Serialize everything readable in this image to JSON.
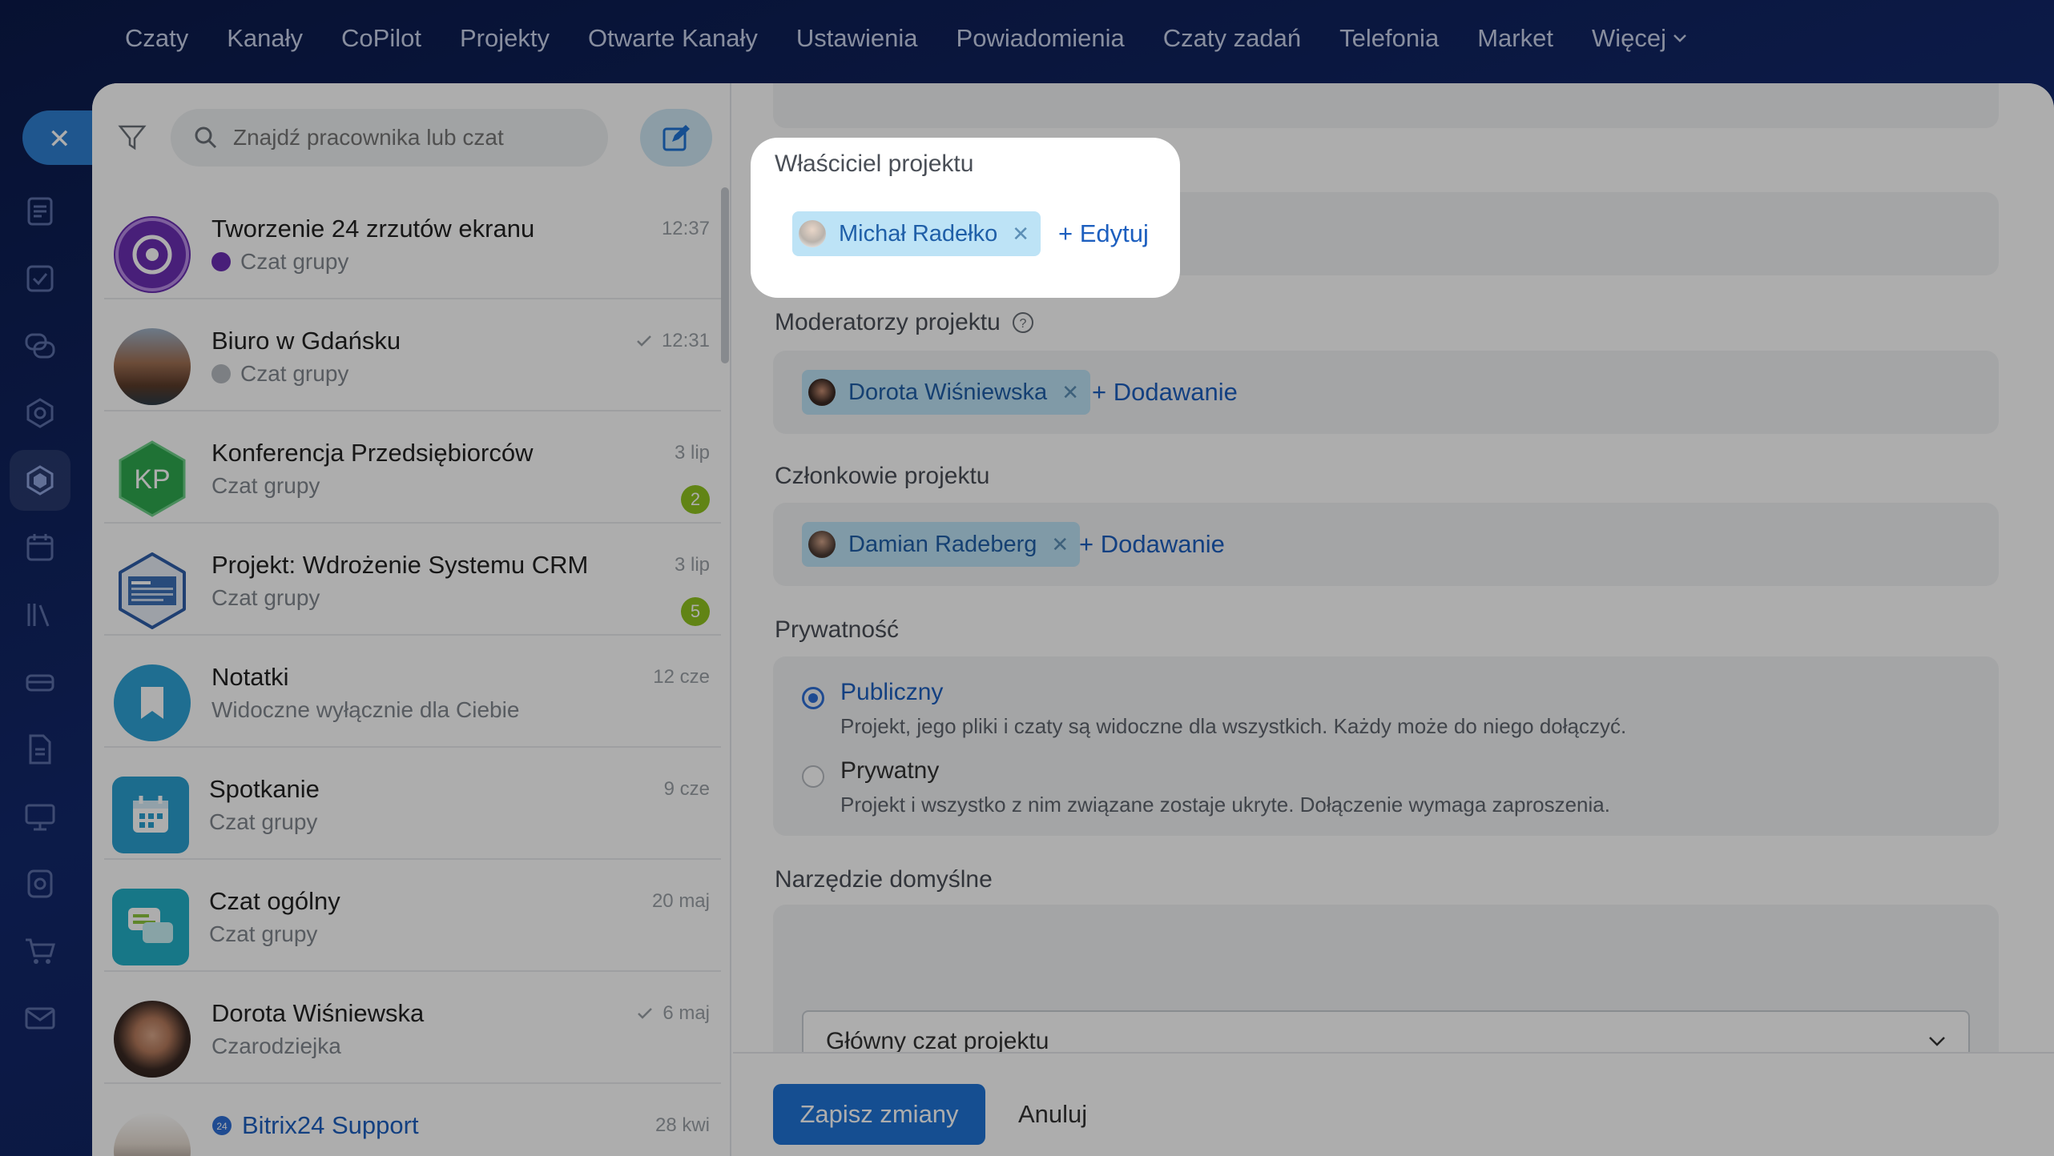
{
  "topnav": {
    "items": [
      "Czaty",
      "Kanały",
      "CoPilot",
      "Projekty",
      "Otwarte Kanały",
      "Ustawienia",
      "Powiadomienia",
      "Czaty zadań",
      "Telefonia",
      "Market",
      "Więcej"
    ]
  },
  "rail": {
    "close_icon": "close-icon",
    "icons": [
      "feed-icon",
      "tasks-icon",
      "chats-icon",
      "copilot-icon",
      "projects-icon",
      "calendar-icon",
      "knowledge-icon",
      "crm-icon",
      "documents-icon",
      "sites-icon",
      "automation-icon",
      "shop-icon",
      "mail-icon"
    ]
  },
  "chatlist": {
    "search_placeholder": "Znajdź pracownika lub czat",
    "items": [
      {
        "name": "Tworzenie 24 zrzutów ekranu",
        "sub": "Czat grupy",
        "time": "12:37",
        "badge": "",
        "read": false,
        "avatar": "copilot-avatar"
      },
      {
        "name": "Biuro w Gdańsku",
        "sub": "Czat grupy",
        "time": "12:31",
        "badge": "",
        "read": true,
        "avatar": "city-photo-avatar"
      },
      {
        "name": "Konferencja Przedsiębiorców",
        "sub": "Czat grupy",
        "time": "3 lip",
        "badge": "2",
        "read": false,
        "avatar": "initials-avatar",
        "initials": "KP"
      },
      {
        "name": "Projekt: Wdrożenie Systemu CRM",
        "sub": "Czat grupy",
        "time": "3 lip",
        "badge": "5",
        "read": false,
        "avatar": "crm-screenshot-avatar"
      },
      {
        "name": "Notatki",
        "sub": "Widoczne wyłącznie dla Ciebie",
        "time": "12 cze",
        "badge": "",
        "read": false,
        "avatar": "bookmark-avatar"
      },
      {
        "name": "Spotkanie",
        "sub": "Czat grupy",
        "time": "9 cze",
        "badge": "",
        "read": false,
        "avatar": "calendar-avatar"
      },
      {
        "name": "Czat ogólny",
        "sub": "Czat grupy",
        "time": "20 maj",
        "badge": "",
        "read": false,
        "avatar": "chat-bubbles-avatar"
      },
      {
        "name": "Dorota Wiśniewska",
        "sub": "Czarodziejka",
        "time": "6 maj",
        "badge": "",
        "read": true,
        "avatar": "person-avatar"
      },
      {
        "name": "Bitrix24 Support",
        "sub": "",
        "time": "28 kwi",
        "badge": "",
        "read": false,
        "avatar": "support-avatar"
      }
    ]
  },
  "form": {
    "owner_label": "Właściciel projektu",
    "owner_name": "Michał Radełko",
    "owner_edit": "+ Edytuj",
    "moderators_label": "Moderatorzy projektu",
    "moderator_name": "Dorota Wiśniewska",
    "moderators_add": "+ Dodawanie",
    "members_label": "Członkowie projektu",
    "member_name": "Damian Radeberg",
    "members_add": "+ Dodawanie",
    "privacy_label": "Prywatność",
    "public_title": "Publiczny",
    "public_desc": "Projekt, jego pliki i czaty są widoczne dla wszystkich. Każdy może do niego dołączyć.",
    "private_title": "Prywatny",
    "private_desc": "Projekt i wszystko z nim związane zostaje ukryte. Dołączenie wymaga zaproszenia.",
    "privacy_selected": "Publiczny",
    "default_tool_label": "Narzędzie domyślne",
    "default_tool_value": "Główny czat projektu",
    "save": "Zapisz zmiany",
    "cancel": "Anuluj"
  },
  "colors": {
    "accent": "#1f73d6",
    "chip_bg": "#bde3f6",
    "badge": "#8fc31f",
    "nav_bg": "#0d1d55"
  }
}
